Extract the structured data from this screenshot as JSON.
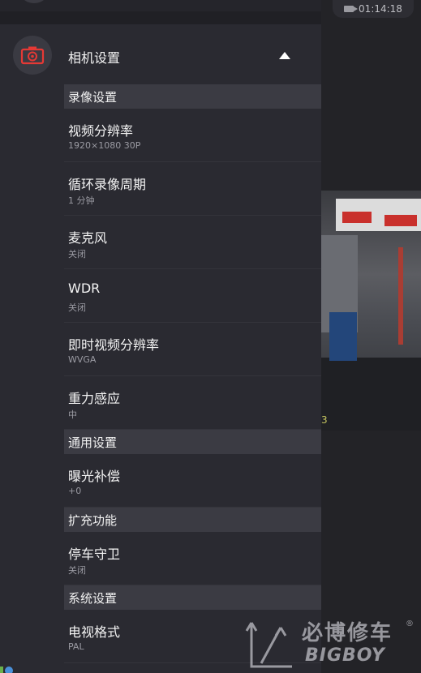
{
  "status": {
    "recording_time": "01:14:18"
  },
  "preview": {
    "corner_digit": "3"
  },
  "watermark": {
    "cn": "必博修车",
    "en": "BIGBOY",
    "reg": "®"
  },
  "drawer": {
    "header": {
      "title": "相机设置",
      "icon": "camera-settings-icon",
      "accent": "#e53935"
    },
    "sections": [
      {
        "title": "录像设置",
        "items": [
          {
            "title": "视频分辨率",
            "value": "1920×1080 30P"
          },
          {
            "title": "循环录像周期",
            "value": "1 分钟"
          },
          {
            "title": "麦克风",
            "value": "关闭"
          },
          {
            "title": "WDR",
            "value": "关闭"
          },
          {
            "title": "即时视频分辨率",
            "value": "WVGA"
          },
          {
            "title": "重力感应",
            "value": "中"
          }
        ]
      },
      {
        "title": "通用设置",
        "items": [
          {
            "title": "曝光补偿",
            "value": "+0"
          }
        ]
      },
      {
        "title": "扩充功能",
        "items": [
          {
            "title": "停车守卫",
            "value": "关闭"
          }
        ]
      },
      {
        "title": "系统设置",
        "items": [
          {
            "title": "电视格式",
            "value": "PAL"
          }
        ]
      }
    ]
  }
}
